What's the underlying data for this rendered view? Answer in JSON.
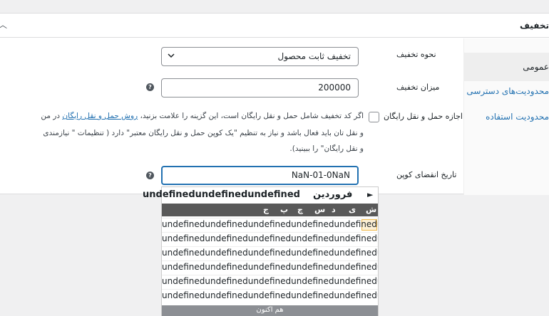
{
  "panel": {
    "title": "تخفیف"
  },
  "tabs": [
    {
      "label": "عمومی"
    },
    {
      "label": "محدودیت‌های دسترسی"
    },
    {
      "label": "محدودیت استفاده"
    }
  ],
  "fields": {
    "discount_type": {
      "label": "نحوه تخفیف",
      "value": "تخفیف ثابت محصول"
    },
    "amount": {
      "label": "میزان تخفیف",
      "value": "200000"
    },
    "free_shipping": {
      "label": "اجازه حمل و نقل رایگان",
      "desc_line1_pre": "اگر کد تخفیف شامل حمل و نقل رایگان است، این گزینه را علامت بزنید، ",
      "desc_line1_link": "روش حمل و نقل رایگان",
      "desc_line1_post": " در من",
      "desc_line2": "و نقل تان باید فعال باشد و نیاز به تنظیم \"یک کوپن حمل و نقل رایگان معتبر\" دارد ( تنظیمات \" نیازمندی",
      "desc_line3": "و نقل رایگان\" را ببینید)."
    },
    "expiry": {
      "label": "تاریخ انقضای کوپن",
      "value": "NaN-01-0NaN"
    }
  },
  "datepicker": {
    "month": "فروردین",
    "year": "undefinedundefinedundefined",
    "next_symbol": "►",
    "weekdays": [
      "ش",
      "ی",
      "د",
      "س",
      "چ",
      "پ",
      "ج"
    ],
    "row_text": "undefinedundefinedundefinedundefinedundefinedundefinedundefined",
    "rows": 6,
    "today_button": "هم اکنون"
  }
}
